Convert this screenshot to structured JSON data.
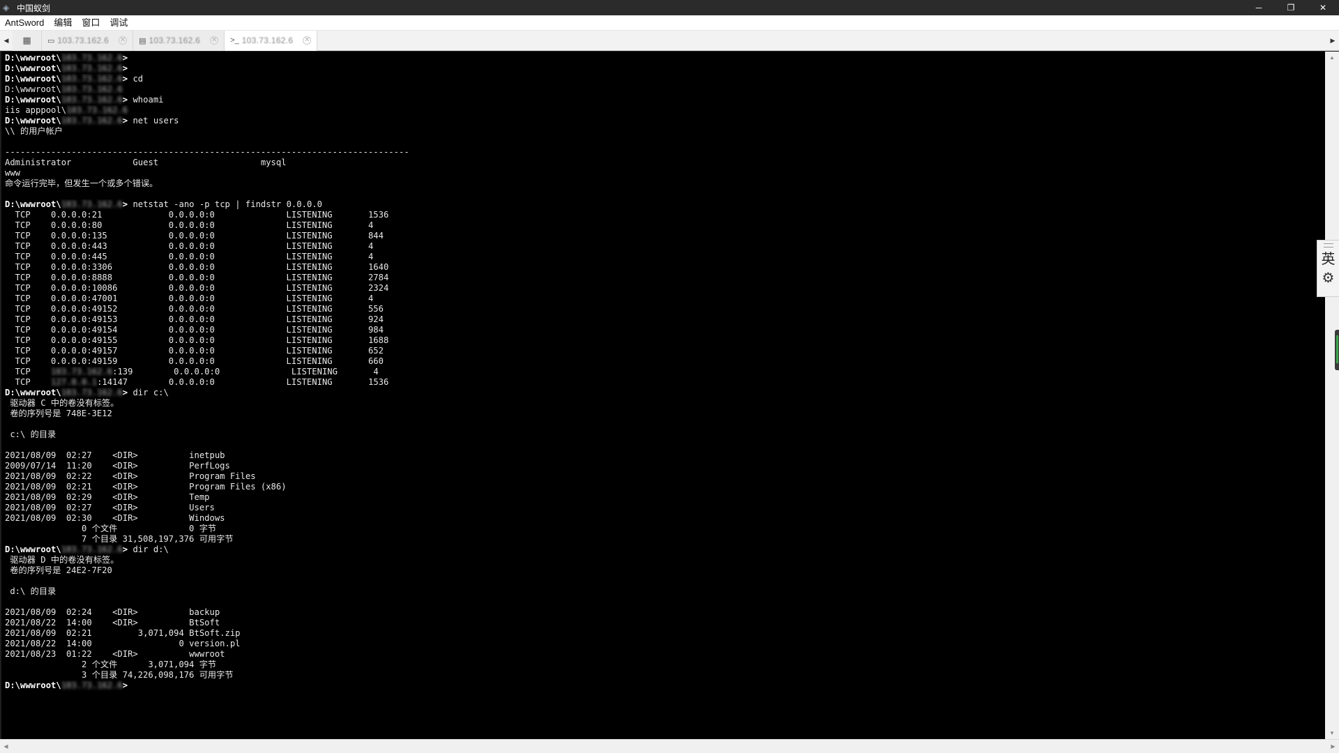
{
  "window": {
    "title": "中国蚁剑",
    "controls": {
      "minimize": "─",
      "restore": "❐",
      "close": "✕"
    }
  },
  "menubar": {
    "items": [
      "AntSword",
      "编辑",
      "窗口",
      "调试"
    ]
  },
  "tabs": {
    "grid_icon": "▦",
    "items": [
      {
        "icon": "folder-icon",
        "glyph": "▭",
        "label": "103.73.162.6",
        "close": "✕",
        "active": false
      },
      {
        "icon": "database-icon",
        "glyph": "▤",
        "label": "103.73.162.6",
        "close": "✕",
        "active": false
      },
      {
        "icon": "terminal-icon",
        "glyph": ">_",
        "label": "103.73.162.6",
        "close": "✕",
        "active": true
      }
    ],
    "scroll_left": "◀",
    "scroll_right": "▶"
  },
  "terminal": {
    "lines": [
      [
        {
          "t": "D:\\wwwroot\\",
          "p": 1
        },
        {
          "t": "103.73.162.6",
          "b": 1
        },
        {
          "t": ">",
          "p": 1
        }
      ],
      [
        {
          "t": "D:\\wwwroot\\",
          "p": 1
        },
        {
          "t": "103.73.162.6",
          "b": 1
        },
        {
          "t": ">",
          "p": 1
        }
      ],
      [
        {
          "t": "D:\\wwwroot\\",
          "p": 1
        },
        {
          "t": "103.73.162.6",
          "b": 1
        },
        {
          "t": "> ",
          "p": 1
        },
        {
          "t": "cd"
        }
      ],
      [
        {
          "t": "D:\\wwwroot\\"
        },
        {
          "t": "103.73.162.6",
          "b": 1
        }
      ],
      [
        {
          "t": "D:\\wwwroot\\",
          "p": 1
        },
        {
          "t": "103.73.162.6",
          "b": 1
        },
        {
          "t": "> ",
          "p": 1
        },
        {
          "t": "whoami"
        }
      ],
      [
        {
          "t": "iis apppool\\"
        },
        {
          "t": "103.73.162.6",
          "b": 1
        }
      ],
      [
        {
          "t": "D:\\wwwroot\\",
          "p": 1
        },
        {
          "t": "103.73.162.6",
          "b": 1
        },
        {
          "t": "> ",
          "p": 1
        },
        {
          "t": "net users"
        }
      ],
      [
        {
          "t": "\\\\ 的用户帐户"
        }
      ],
      [
        {
          "t": ""
        }
      ],
      [
        {
          "t": "-------------------------------------------------------------------------------"
        }
      ],
      [
        {
          "t": "Administrator            Guest                    mysql"
        }
      ],
      [
        {
          "t": "www"
        }
      ],
      [
        {
          "t": "命令运行完毕，但发生一个或多个错误。"
        }
      ],
      [
        {
          "t": ""
        }
      ],
      [
        {
          "t": "D:\\wwwroot\\",
          "p": 1
        },
        {
          "t": "103.73.162.6",
          "b": 1
        },
        {
          "t": "> ",
          "p": 1
        },
        {
          "t": "netstat -ano -p tcp | findstr 0.0.0.0"
        }
      ],
      [
        {
          "t": "  TCP    0.0.0.0:21             0.0.0.0:0              LISTENING       1536"
        }
      ],
      [
        {
          "t": "  TCP    0.0.0.0:80             0.0.0.0:0              LISTENING       4"
        }
      ],
      [
        {
          "t": "  TCP    0.0.0.0:135            0.0.0.0:0              LISTENING       844"
        }
      ],
      [
        {
          "t": "  TCP    0.0.0.0:443            0.0.0.0:0              LISTENING       4"
        }
      ],
      [
        {
          "t": "  TCP    0.0.0.0:445            0.0.0.0:0              LISTENING       4"
        }
      ],
      [
        {
          "t": "  TCP    0.0.0.0:3306           0.0.0.0:0              LISTENING       1640"
        }
      ],
      [
        {
          "t": "  TCP    0.0.0.0:8888           0.0.0.0:0              LISTENING       2784"
        }
      ],
      [
        {
          "t": "  TCP    0.0.0.0:10086          0.0.0.0:0              LISTENING       2324"
        }
      ],
      [
        {
          "t": "  TCP    0.0.0.0:47001          0.0.0.0:0              LISTENING       4"
        }
      ],
      [
        {
          "t": "  TCP    0.0.0.0:49152          0.0.0.0:0              LISTENING       556"
        }
      ],
      [
        {
          "t": "  TCP    0.0.0.0:49153          0.0.0.0:0              LISTENING       924"
        }
      ],
      [
        {
          "t": "  TCP    0.0.0.0:49154          0.0.0.0:0              LISTENING       984"
        }
      ],
      [
        {
          "t": "  TCP    0.0.0.0:49155          0.0.0.0:0              LISTENING       1688"
        }
      ],
      [
        {
          "t": "  TCP    0.0.0.0:49157          0.0.0.0:0              LISTENING       652"
        }
      ],
      [
        {
          "t": "  TCP    0.0.0.0:49159          0.0.0.0:0              LISTENING       660"
        }
      ],
      [
        {
          "t": "  TCP    "
        },
        {
          "t": "103.73.162.6",
          "b": 1
        },
        {
          "t": ":139        0.0.0.0:0              LISTENING       4"
        }
      ],
      [
        {
          "t": "  TCP    "
        },
        {
          "t": "127.0.0.1",
          "b": 1
        },
        {
          "t": ":14147        0.0.0.0:0              LISTENING       1536"
        }
      ],
      [
        {
          "t": "D:\\wwwroot\\",
          "p": 1
        },
        {
          "t": "103.73.162.6",
          "b": 1
        },
        {
          "t": "> ",
          "p": 1
        },
        {
          "t": "dir c:\\"
        }
      ],
      [
        {
          "t": " 驱动器 C 中的卷没有标签。"
        }
      ],
      [
        {
          "t": " 卷的序列号是 748E-3E12"
        }
      ],
      [
        {
          "t": ""
        }
      ],
      [
        {
          "t": " c:\\ 的目录"
        }
      ],
      [
        {
          "t": ""
        }
      ],
      [
        {
          "t": "2021/08/09  02:27    <DIR>          inetpub"
        }
      ],
      [
        {
          "t": "2009/07/14  11:20    <DIR>          PerfLogs"
        }
      ],
      [
        {
          "t": "2021/08/09  02:22    <DIR>          Program Files"
        }
      ],
      [
        {
          "t": "2021/08/09  02:21    <DIR>          Program Files (x86)"
        }
      ],
      [
        {
          "t": "2021/08/09  02:29    <DIR>          Temp"
        }
      ],
      [
        {
          "t": "2021/08/09  02:27    <DIR>          Users"
        }
      ],
      [
        {
          "t": "2021/08/09  02:30    <DIR>          Windows"
        }
      ],
      [
        {
          "t": "               0 个文件              0 字节"
        }
      ],
      [
        {
          "t": "               7 个目录 31,508,197,376 可用字节"
        }
      ],
      [
        {
          "t": "D:\\wwwroot\\",
          "p": 1
        },
        {
          "t": "103.73.162.6",
          "b": 1
        },
        {
          "t": "> ",
          "p": 1
        },
        {
          "t": "dir d:\\"
        }
      ],
      [
        {
          "t": " 驱动器 D 中的卷没有标签。"
        }
      ],
      [
        {
          "t": " 卷的序列号是 24E2-7F20"
        }
      ],
      [
        {
          "t": ""
        }
      ],
      [
        {
          "t": " d:\\ 的目录"
        }
      ],
      [
        {
          "t": ""
        }
      ],
      [
        {
          "t": "2021/08/09  02:24    <DIR>          backup"
        }
      ],
      [
        {
          "t": "2021/08/22  14:00    <DIR>          BtSoft"
        }
      ],
      [
        {
          "t": "2021/08/09  02:21         3,071,094 BtSoft.zip"
        }
      ],
      [
        {
          "t": "2021/08/22  14:00                 0 version.pl"
        }
      ],
      [
        {
          "t": "2021/08/23  01:22    <DIR>          wwwroot"
        }
      ],
      [
        {
          "t": "               2 个文件      3,071,094 字节"
        }
      ],
      [
        {
          "t": "               3 个目录 74,226,098,176 可用字节"
        }
      ],
      [
        {
          "t": "D:\\wwwroot\\",
          "p": 1
        },
        {
          "t": "103.73.162.6",
          "b": 1
        },
        {
          "t": ">",
          "p": 1
        }
      ]
    ]
  },
  "scrollbars": {
    "up": "▲",
    "down": "▼",
    "left": "◀",
    "right": "▶"
  },
  "ime": {
    "language": "英",
    "settings_glyph": "⚙"
  },
  "colors": {
    "terminal_bg": "#000000",
    "terminal_fg": "#e8e8e8",
    "titlebar_bg": "#2b2b2b",
    "accent_green": "#3fa34d"
  }
}
